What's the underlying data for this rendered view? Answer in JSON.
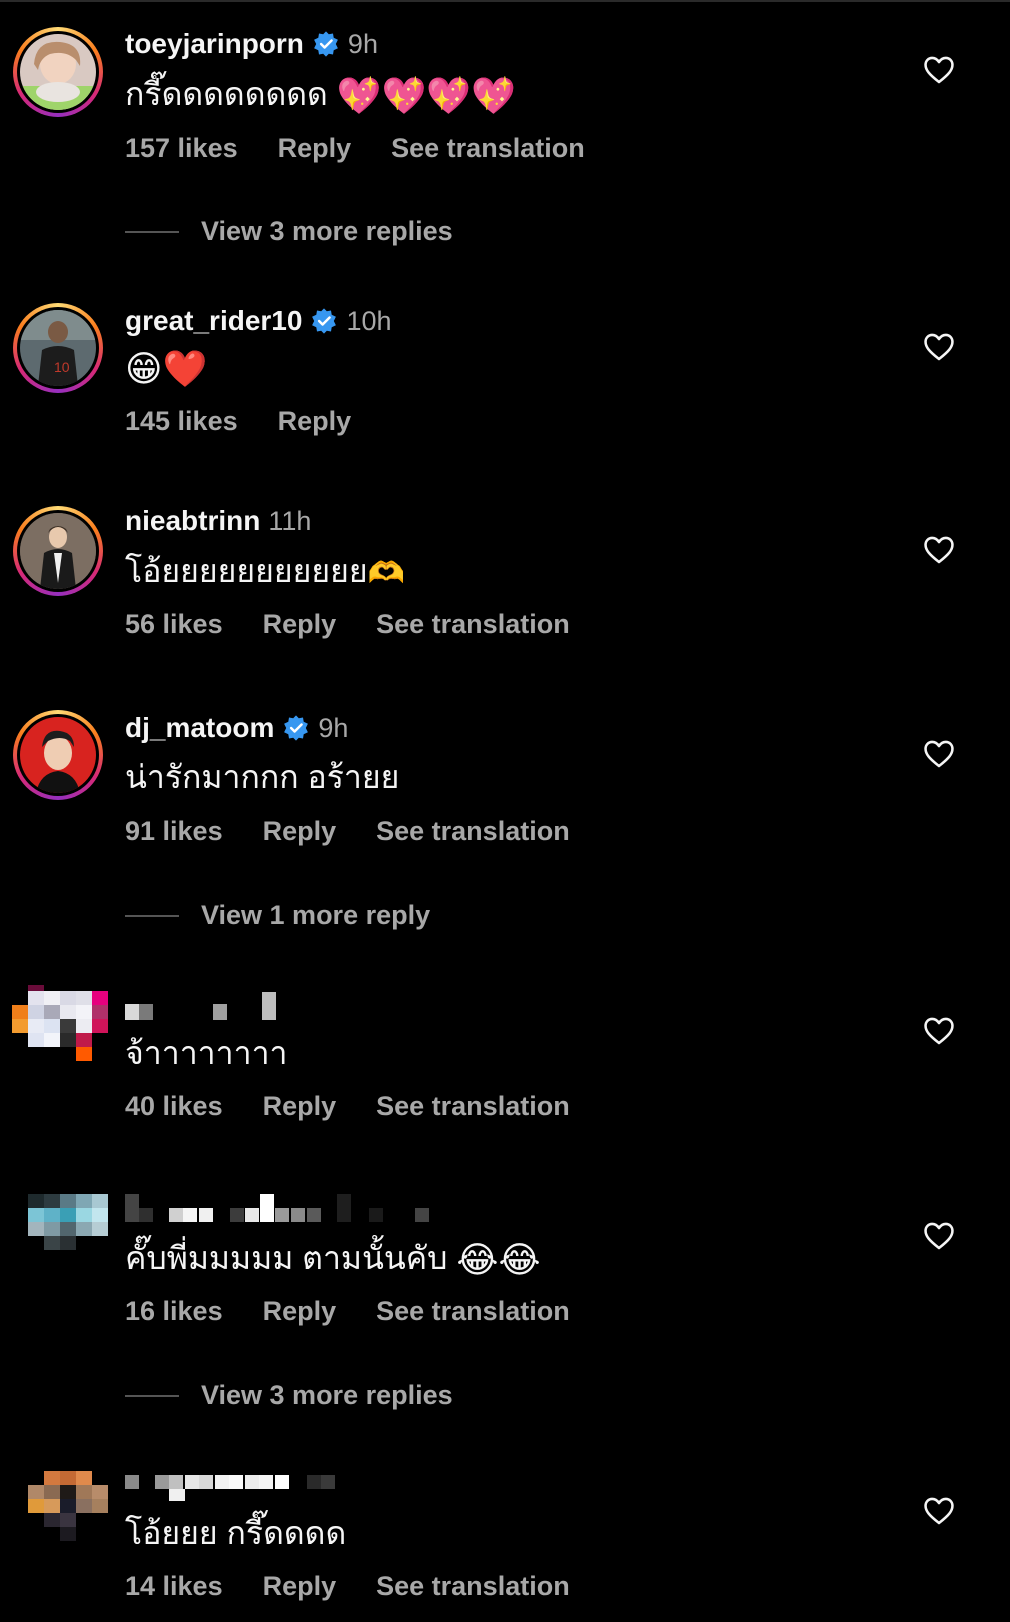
{
  "comments": [
    {
      "username": "toeyjarinporn",
      "verified": true,
      "time": "9h",
      "text": "กรี๊ดดดดดดดด",
      "emoji": "💖💖💖💖",
      "likes": "157 likes",
      "reply": "Reply",
      "translate": "See translation",
      "more_replies": "View 3 more replies"
    },
    {
      "username": "great_rider10",
      "verified": true,
      "time": "10h",
      "text": "",
      "emoji": "😁❤️",
      "likes": "145 likes",
      "reply": "Reply"
    },
    {
      "username": "nieabtrinn",
      "verified": false,
      "time": "11h",
      "text": "โอ้ยยยยยยยยยยย",
      "emoji": "🫶",
      "likes": "56 likes",
      "reply": "Reply",
      "translate": "See translation"
    },
    {
      "username": "dj_matoom",
      "verified": true,
      "time": "9h",
      "text": "น่ารักมากกก อร้ายย",
      "likes": "91 likes",
      "reply": "Reply",
      "translate": "See translation",
      "more_replies": "View 1 more reply"
    },
    {
      "username_hidden": true,
      "text": "จ้าาาาาาาา",
      "likes": "40 likes",
      "reply": "Reply",
      "translate": "See translation"
    },
    {
      "username_hidden": true,
      "text": "คั๊บพี่มมมมม ตามนั้นคับ",
      "emoji": "😂😂",
      "likes": "16 likes",
      "reply": "Reply",
      "translate": "See translation",
      "more_replies": "View 3 more replies"
    },
    {
      "username_hidden": true,
      "text": "โอ้ยยย กรี๊ดดดด",
      "likes": "14 likes",
      "reply": "Reply",
      "translate": "See translation"
    }
  ],
  "colors": {
    "background": "#000000",
    "primary_text": "#f5f5f5",
    "secondary_text": "#a8a8a8",
    "verified_blue": "#3797f0"
  },
  "icons": {
    "like": "heart-outline-icon",
    "verified": "verified-badge-icon"
  }
}
